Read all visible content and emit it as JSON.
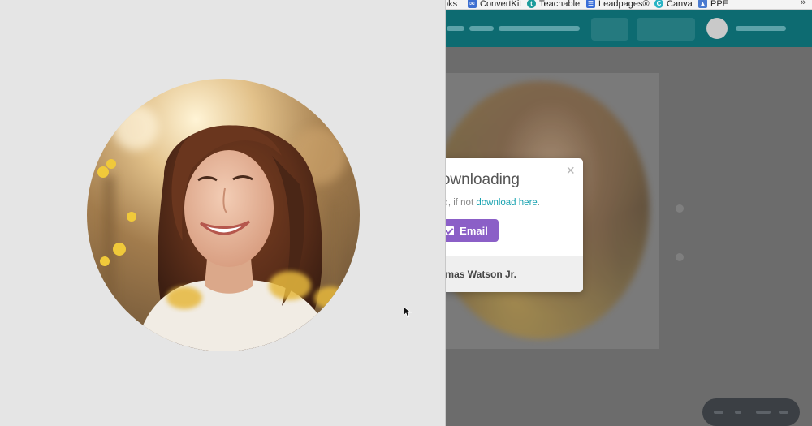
{
  "bookmarks": {
    "items": [
      {
        "label": "oks",
        "icon": "bookmark-folder-icon",
        "color": "#f4f4f4"
      },
      {
        "label": "ConvertKit",
        "icon": "mail-icon",
        "color": "#3d6fd1"
      },
      {
        "label": "Teachable",
        "icon": "teachable-icon",
        "color": "#1d9c9c"
      },
      {
        "label": "Leadpages®",
        "icon": "leadpages-icon",
        "color": "#3a6fd8"
      },
      {
        "label": "Canva",
        "icon": "canva-icon",
        "color": "#27b3c4"
      },
      {
        "label": "PPE",
        "icon": "image-icon",
        "color": "#4a7bd0"
      }
    ],
    "overflow": "»"
  },
  "modal": {
    "title": "downloading",
    "close_glyph": "×",
    "message_prefix": "ced, if not ",
    "message_link": "download here",
    "message_suffix": ".",
    "email_button": "Email",
    "footer_text": "omas Watson Jr."
  },
  "colors": {
    "toolbar": "#0d6b71",
    "email_button": "#8b5fc7",
    "link": "#1aa3b1",
    "preview_bg": "#e5e5e5"
  }
}
